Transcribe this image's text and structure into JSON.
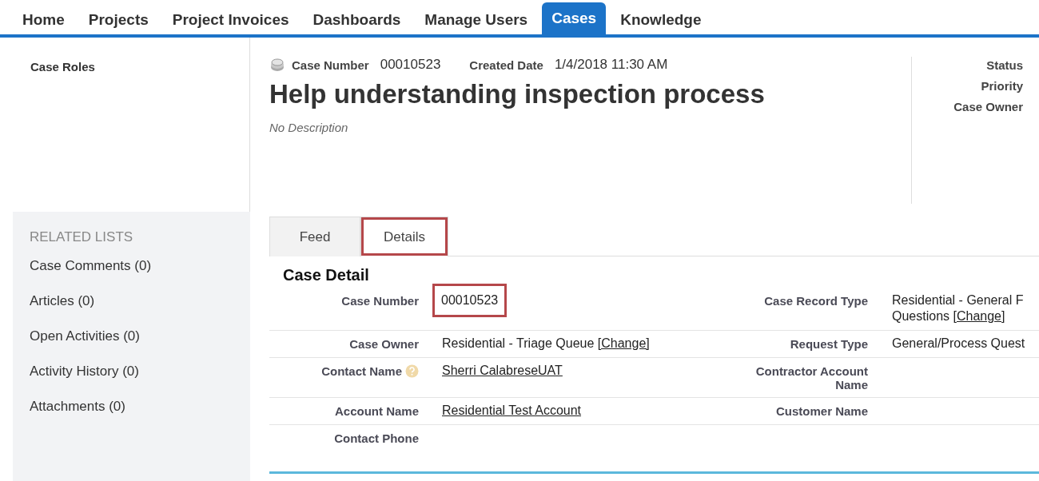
{
  "nav": {
    "tabs": [
      {
        "label": "Home",
        "selected": false
      },
      {
        "label": "Projects",
        "selected": false
      },
      {
        "label": "Project Invoices",
        "selected": false
      },
      {
        "label": "Dashboards",
        "selected": false
      },
      {
        "label": "Manage Users",
        "selected": false
      },
      {
        "label": "Cases",
        "selected": true
      },
      {
        "label": "Knowledge",
        "selected": false
      }
    ]
  },
  "sidebar": {
    "case_roles": "Case Roles",
    "related_lists": {
      "title": "RELATED LISTS",
      "items": [
        "Case Comments (0)",
        "Articles (0)",
        "Open Activities (0)",
        "Activity History (0)",
        "Attachments (0)"
      ]
    }
  },
  "header": {
    "fields": [
      {
        "label": "Case Number",
        "value": "00010523"
      },
      {
        "label": "Created Date",
        "value": "1/4/2018 11:30 AM"
      }
    ],
    "title": "Help understanding inspection process",
    "description": "No Description",
    "side_labels": [
      "Status",
      "Priority",
      "Case Owner"
    ]
  },
  "tabs": [
    {
      "label": "Feed",
      "selected": false,
      "highlighted": false
    },
    {
      "label": "Details",
      "selected": true,
      "highlighted": true
    }
  ],
  "case_detail": {
    "title": "Case Detail",
    "rows": [
      {
        "left": {
          "label": "Case Number",
          "value": "00010523",
          "highlighted": true
        },
        "right": {
          "label": "Case Record Type",
          "value": "Residential - General F\nQuestions",
          "action": "[Change]"
        }
      },
      {
        "left": {
          "label": "Case Owner",
          "value": "Residential - Triage Queue",
          "action": "[Change]"
        },
        "right": {
          "label": "Request Type",
          "value": "General/Process Quest"
        }
      },
      {
        "left": {
          "label": "Contact Name",
          "help": true,
          "value": "Sherri CalabreseUAT",
          "link": true
        },
        "right": {
          "label": "Contractor Account Name"
        }
      },
      {
        "left": {
          "label": "Account Name",
          "value": "Residential Test Account",
          "link": true
        },
        "right": {
          "label": "Customer Name"
        }
      },
      {
        "left": {
          "label": "Contact Phone"
        },
        "right": {}
      }
    ]
  }
}
